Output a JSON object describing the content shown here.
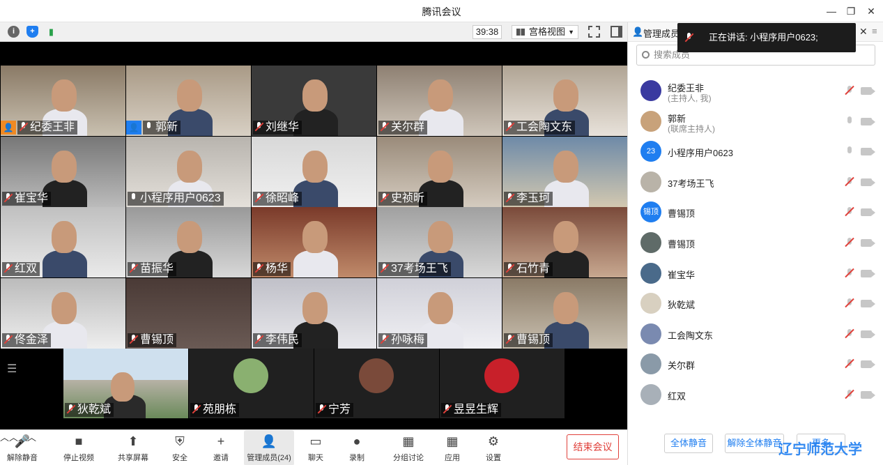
{
  "window": {
    "title": "腾讯会议"
  },
  "toolbar": {
    "timer": "39:38",
    "view": "宫格视图"
  },
  "panel": {
    "title": "管理成员",
    "search_placeholder": "搜索成员",
    "mute_all": "全体静音",
    "unmute_all": "解除全体静音",
    "more": "更多"
  },
  "speaking": {
    "prefix": "正在讲话: ",
    "name": "小程序用户0623;"
  },
  "tiles": [
    {
      "name": "纪委王非",
      "muted": true,
      "host": "orange"
    },
    {
      "name": "郭新",
      "muted": false,
      "host": "blue"
    },
    {
      "name": "刘继华",
      "muted": true
    },
    {
      "name": "关尔群",
      "muted": true
    },
    {
      "name": "工会陶文东",
      "muted": true
    },
    {
      "name": "崔宝华",
      "muted": true
    },
    {
      "name": "小程序用户0623",
      "muted": false
    },
    {
      "name": "徐昭峰",
      "muted": true
    },
    {
      "name": "史祯昕",
      "muted": true
    },
    {
      "name": "李玉珂",
      "muted": true
    },
    {
      "name": "红双",
      "muted": true
    },
    {
      "name": "苗振华",
      "muted": true
    },
    {
      "name": "杨华",
      "muted": true
    },
    {
      "name": "37考场王飞",
      "muted": true
    },
    {
      "name": "石竹青",
      "muted": true
    },
    {
      "name": "佟金泽",
      "muted": true
    },
    {
      "name": "曹锡顶",
      "muted": true
    },
    {
      "name": "李伟民",
      "muted": true
    },
    {
      "name": "孙咏梅",
      "muted": true
    },
    {
      "name": "曹锡顶",
      "muted": true
    },
    {
      "name": "狄乾斌",
      "muted": true
    },
    {
      "name": "苑朋栋",
      "muted": true
    },
    {
      "name": "宁芳",
      "muted": true
    },
    {
      "name": "昱昱生辉",
      "muted": true
    }
  ],
  "members": [
    {
      "name": "纪委王非",
      "role": "(主持人, 我)",
      "muted": true,
      "avatar_color": "#3a3aa0"
    },
    {
      "name": "郭新",
      "role": "(联席主持人)",
      "muted": false,
      "avatar_color": "#c8a27a"
    },
    {
      "name": "小程序用户0623",
      "role": "",
      "muted": false,
      "avatar_color": "#1f7ef0",
      "avatar_text": "23"
    },
    {
      "name": "37考场王飞",
      "role": "",
      "muted": true,
      "avatar_color": "#b9b3a8"
    },
    {
      "name": "曹锡顶",
      "role": "",
      "muted": true,
      "avatar_color": "#1f7ef0",
      "avatar_text": "锡顶"
    },
    {
      "name": "曹锡顶",
      "role": "",
      "muted": true,
      "avatar_color": "#5f6b68"
    },
    {
      "name": "崔宝华",
      "role": "",
      "muted": true,
      "avatar_color": "#4a6a8a"
    },
    {
      "name": "狄乾斌",
      "role": "",
      "muted": true,
      "avatar_color": "#d8d0c0"
    },
    {
      "name": "工会陶文东",
      "role": "",
      "muted": true,
      "avatar_color": "#7a8ab0"
    },
    {
      "name": "关尔群",
      "role": "",
      "muted": true,
      "avatar_color": "#8a9aa8"
    },
    {
      "name": "红双",
      "role": "",
      "muted": true,
      "avatar_color": "#a8b0b8"
    }
  ],
  "bottom": [
    {
      "label": "解除静音",
      "chev": true
    },
    {
      "label": "停止视频",
      "chev": true
    },
    {
      "label": "共享屏幕",
      "chev": true
    },
    {
      "label": "安全"
    },
    {
      "label": "邀请"
    },
    {
      "label": "管理成员(24)",
      "active": true
    },
    {
      "label": "聊天"
    },
    {
      "label": "录制",
      "chev": true
    },
    {
      "label": "分组讨论"
    },
    {
      "label": "应用"
    },
    {
      "label": "设置"
    }
  ],
  "end_label": "结束会议",
  "watermark": "辽宁师范大学"
}
